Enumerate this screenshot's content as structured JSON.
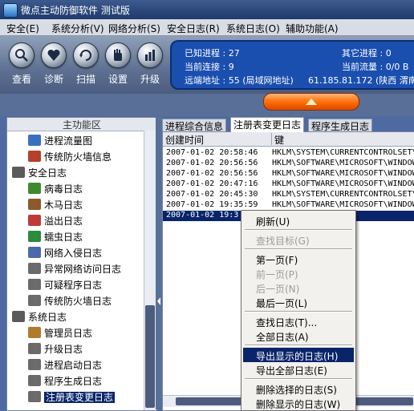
{
  "window": {
    "title": "微点主动防御软件   测试版"
  },
  "menubar": [
    {
      "label": "安全(E)"
    },
    {
      "label": "系统分析(V)"
    },
    {
      "label": "网络分析(S)"
    },
    {
      "label": "安全日志(R)"
    },
    {
      "label": "系统日志(O)"
    },
    {
      "label": "辅助功能(A)"
    }
  ],
  "toolbar": [
    {
      "label": "查看",
      "icon": "magnifier-icon"
    },
    {
      "label": "诊断",
      "icon": "heart-icon"
    },
    {
      "label": "扫描",
      "icon": "scan-icon"
    },
    {
      "label": "设置",
      "icon": "hand-icon"
    },
    {
      "label": "升级",
      "icon": "upgrade-icon"
    }
  ],
  "info": {
    "known_processes": "已知进程 : 27",
    "other_processes": "其它进程 : 0",
    "current_connections": "当前连接 : 9",
    "current_traffic": "当前流量 : 0/0 B",
    "remote_address": "远端地址 : 55 (局域网地址)",
    "remote_ip": "61.185.81.172 (陕西 渭南"
  },
  "left_panel": {
    "header": "主功能区",
    "items": [
      {
        "label": "进程流量图",
        "icon": "chart-icon"
      },
      {
        "label": "传统防火墙信息",
        "icon": "firewall-icon"
      },
      {
        "label": "安全日志",
        "icon": "log-icon"
      },
      {
        "label": "病毒日志",
        "icon": "virus-icon"
      },
      {
        "label": "木马日志",
        "icon": "horse-icon"
      },
      {
        "label": "溢出日志",
        "icon": "overflow-icon"
      },
      {
        "label": "蠕虫日志",
        "icon": "worm-icon"
      },
      {
        "label": "网络入侵日志",
        "icon": "sword-icon"
      },
      {
        "label": "异常网络访问日志",
        "icon": "document-icon"
      },
      {
        "label": "可疑程序日志",
        "icon": "document-icon"
      },
      {
        "label": "传统防火墙日志",
        "icon": "document-icon"
      },
      {
        "label": "系统日志",
        "icon": "log-icon"
      },
      {
        "label": "管理员日志",
        "icon": "admin-icon"
      },
      {
        "label": "升级日志",
        "icon": "document-icon"
      },
      {
        "label": "进程启动日志",
        "icon": "document-icon"
      },
      {
        "label": "程序生成日志",
        "icon": "document-icon"
      },
      {
        "label": "注册表变更日志",
        "icon": "document-icon"
      }
    ]
  },
  "tabs": [
    {
      "label": "进程综合信息"
    },
    {
      "label": "注册表变更日志"
    },
    {
      "label": "程序生成日志"
    }
  ],
  "table": {
    "columns": [
      "创建时间",
      "键"
    ],
    "rows": [
      [
        "2007-01-02 20:58:46",
        "HKLM\\SYSTEM\\CURRENTCONTROLSET\\"
      ],
      [
        "2007-01-02 20:56:56",
        "HKLM\\SOFTWARE\\MICROSOFT\\WINDOW"
      ],
      [
        "2007-01-02 20:56:56",
        "HKLM\\SOFTWARE\\MICROSOFT\\WINDOW"
      ],
      [
        "2007-01-02 20:47:16",
        "HKLM\\SOFTWARE\\MICROSOFT\\WINDOW"
      ],
      [
        "2007-01-02 20:45:30",
        "HKLM\\SYSTEM\\CURRENTCONTROLSET\\"
      ],
      [
        "2007-01-02 19:35:59",
        "HKLM\\SOFTWARE\\MICROSOFT\\WINDOW"
      ],
      [
        "2007-01-02 19:3",
        "ROSOFT\\WINDOW"
      ]
    ]
  },
  "context_menu": {
    "groups": [
      [
        {
          "label": "刷新(U)",
          "enabled": true
        }
      ],
      [
        {
          "label": "查找目标(G)",
          "enabled": false
        }
      ],
      [
        {
          "label": "第一页(F)",
          "enabled": true
        },
        {
          "label": "前一页(P)",
          "enabled": false
        },
        {
          "label": "后一页(N)",
          "enabled": false
        },
        {
          "label": "最后一页(L)",
          "enabled": true
        }
      ],
      [
        {
          "label": "查找日志(T)...",
          "enabled": true
        },
        {
          "label": "全部日志(A)",
          "enabled": true
        }
      ],
      [
        {
          "label": "导出显示的日志(H)",
          "enabled": true,
          "highlighted": true
        },
        {
          "label": "导出全部日志(E)",
          "enabled": true
        }
      ],
      [
        {
          "label": "删除选择的日志(S)",
          "enabled": true
        },
        {
          "label": "删除显示的日志(W)",
          "enabled": true
        }
      ]
    ]
  },
  "colors": {
    "selection": "#0a246a",
    "accent_orange": "#ff6a00",
    "info_blue": "#1a4fb0"
  }
}
